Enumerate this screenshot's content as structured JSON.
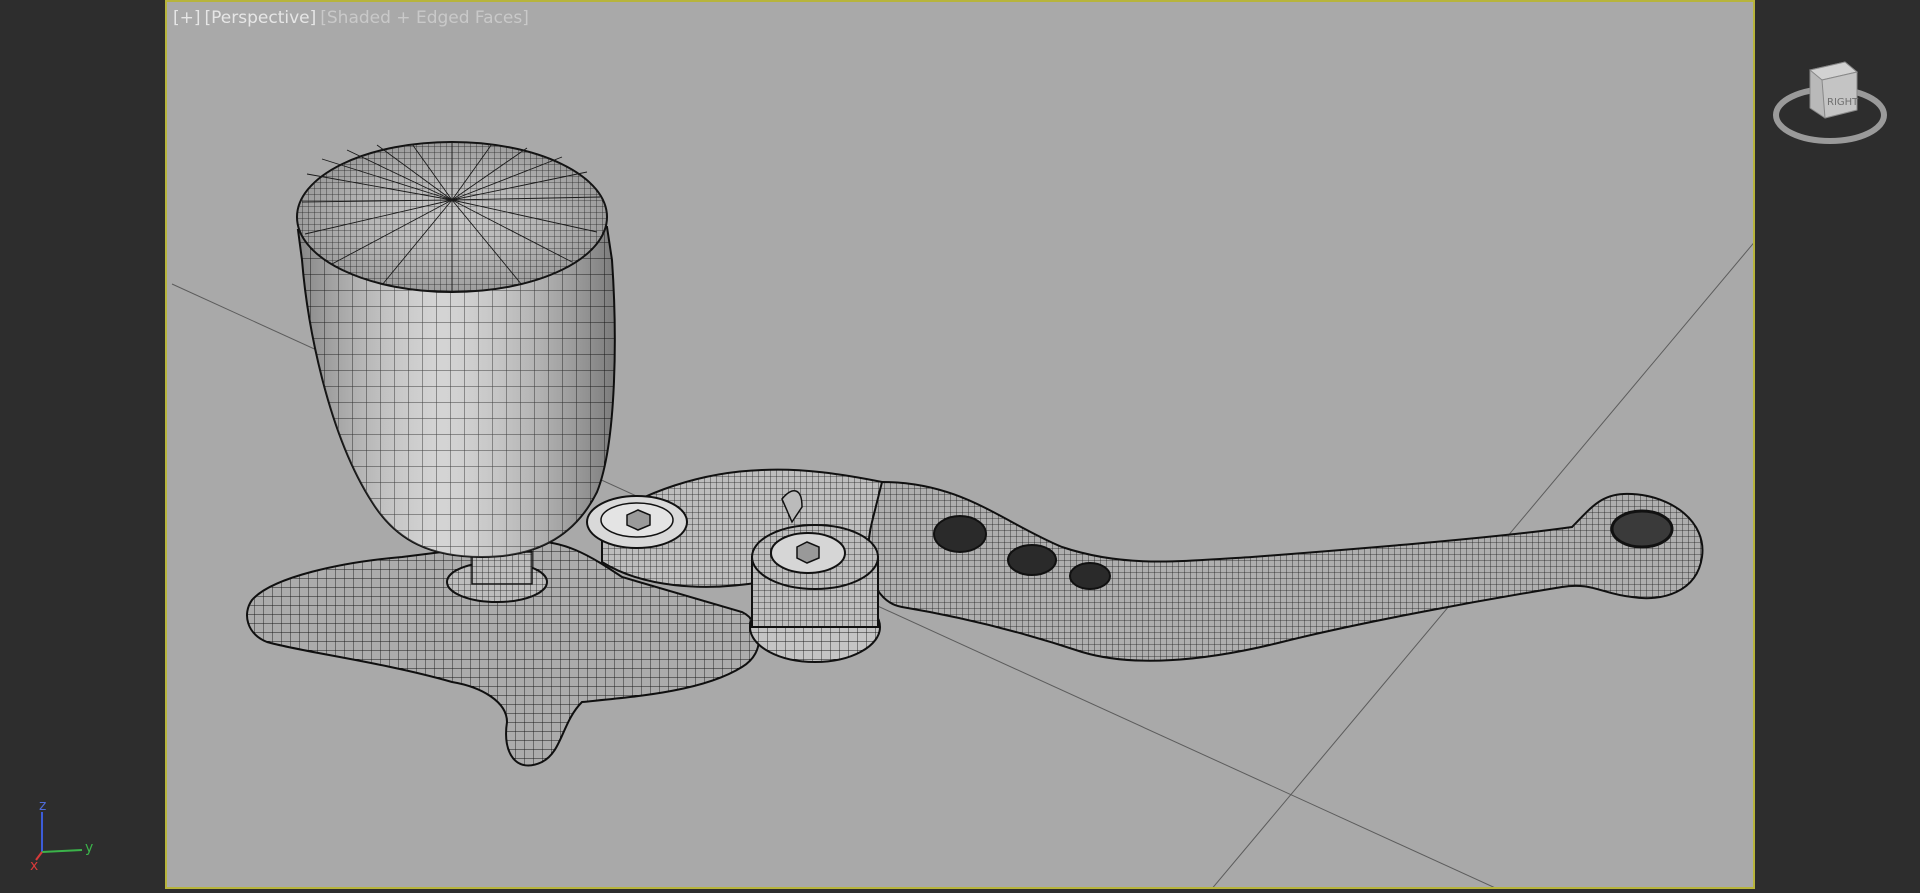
{
  "viewport": {
    "label_plus": "[+]",
    "label_view": "[Perspective]",
    "label_shading": "[Shaded + Edged Faces]"
  },
  "axis_gizmo": {
    "x": "x",
    "y": "y",
    "z": "z"
  },
  "viewcube": {
    "face": "RIGHT"
  },
  "colors": {
    "background": "#2d2d2d",
    "viewport_bg": "#a9a9a9",
    "viewport_border": "#b7b43c",
    "mesh_fill": "#cfcfcf",
    "wire": "#1a1a1a"
  },
  "icons": [
    "axis-tripod-icon",
    "viewcube-icon"
  ]
}
